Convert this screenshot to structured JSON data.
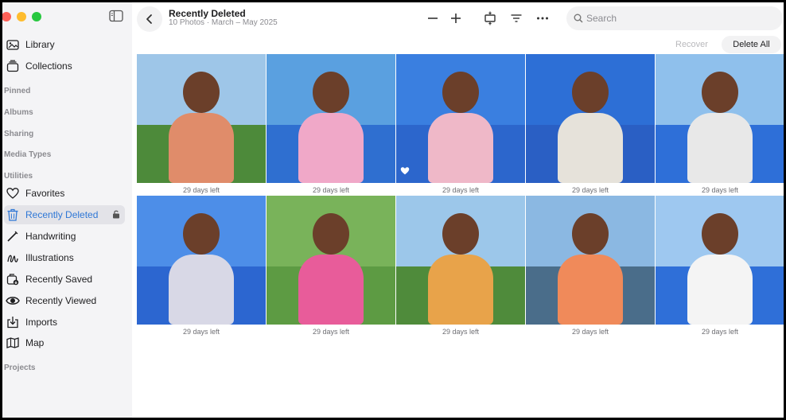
{
  "sidebar": {
    "items": [
      {
        "label": "Library",
        "icon": "library-icon"
      },
      {
        "label": "Collections",
        "icon": "collections-icon"
      }
    ],
    "sections": [
      "Pinned",
      "Albums",
      "Sharing",
      "Media Types",
      "Utilities"
    ],
    "utilities": [
      {
        "label": "Favorites",
        "icon": "heart-icon"
      },
      {
        "label": "Recently Deleted",
        "icon": "trash-icon",
        "active": true
      },
      {
        "label": "Handwriting",
        "icon": "pen-icon"
      },
      {
        "label": "Illustrations",
        "icon": "illustrations-icon"
      },
      {
        "label": "Recently Saved",
        "icon": "recently-saved-icon"
      },
      {
        "label": "Recently Viewed",
        "icon": "eye-icon"
      },
      {
        "label": "Imports",
        "icon": "import-icon"
      },
      {
        "label": "Map",
        "icon": "map-icon"
      }
    ],
    "projects_label": "Projects"
  },
  "header": {
    "title": "Recently Deleted",
    "subtitle": "10 Photos · March – May 2025",
    "search_placeholder": "Search",
    "recover_label": "Recover",
    "delete_all_label": "Delete All"
  },
  "photos": [
    {
      "caption": "29 days left",
      "sky": "#9ec6e8",
      "ground": "#4d8a3a",
      "figure": "#e08c6a"
    },
    {
      "caption": "29 days left",
      "sky": "#5aa0e0",
      "ground": "#2f6fd0",
      "figure": "#f0a8c8"
    },
    {
      "caption": "29 days left",
      "sky": "#3a7fe0",
      "ground": "#2c66cc",
      "figure": "#efb8c8",
      "favorite": true
    },
    {
      "caption": "29 days left",
      "sky": "#2d6fd6",
      "ground": "#2a5fc4",
      "figure": "#e6e2da"
    },
    {
      "caption": "29 days left",
      "sky": "#8fc0ec",
      "ground": "#2e6fd8",
      "figure": "#e8e8e8"
    },
    {
      "caption": "29 days left",
      "sky": "#4d8ee8",
      "ground": "#2c66d0",
      "figure": "#d8d8e6"
    },
    {
      "caption": "29 days left",
      "sky": "#79b35a",
      "ground": "#5d9b43",
      "figure": "#e85c9a"
    },
    {
      "caption": "29 days left",
      "sky": "#9cc7ea",
      "ground": "#4f8b3b",
      "figure": "#e8a34a"
    },
    {
      "caption": "29 days left",
      "sky": "#8bb8e2",
      "ground": "#4a6d8a",
      "figure": "#f08a5a"
    },
    {
      "caption": "29 days left",
      "sky": "#9ec8f0",
      "ground": "#2f6fd8",
      "figure": "#f4f4f4"
    }
  ],
  "colors": {
    "accent": "#2e77d6",
    "sidebar_bg": "#f4f4f6"
  }
}
